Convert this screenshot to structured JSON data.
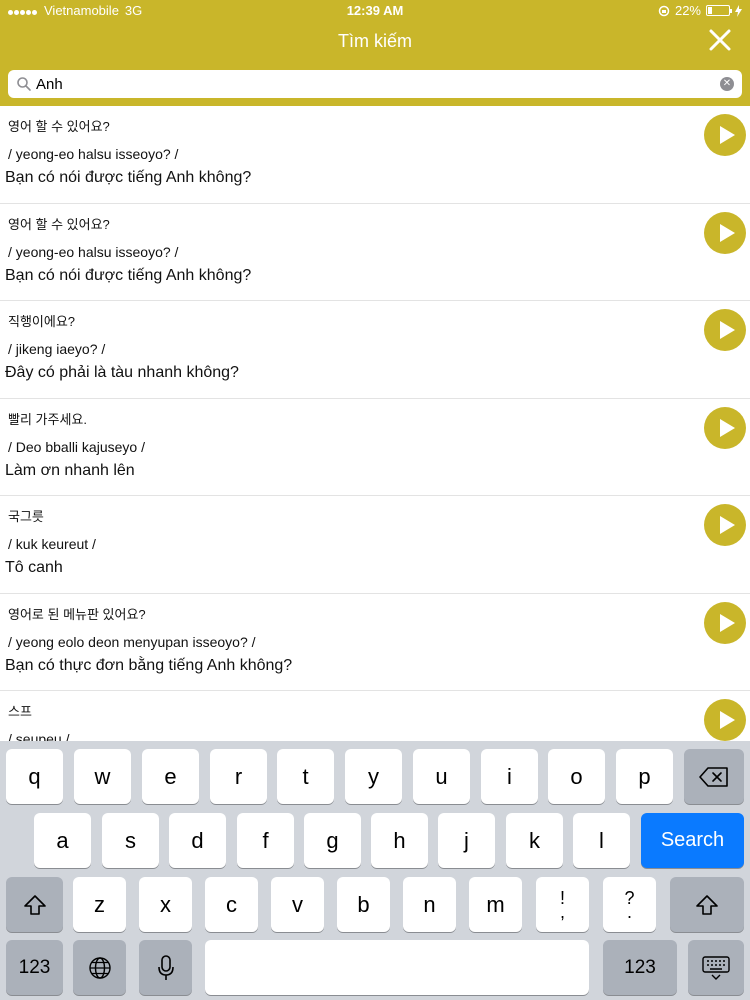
{
  "status_bar": {
    "carrier": "Vietnamobile",
    "network": "3G",
    "time": "12:39 AM",
    "battery": "22%",
    "battery_level": 0.22
  },
  "header": {
    "title": "Tìm kiếm",
    "close_icon": "close-icon"
  },
  "search": {
    "value": "Anh",
    "icon": "search-icon"
  },
  "results": [
    {
      "korean": "영어 할 수 있어요?",
      "romanization": "/ yeong-eo halsu isseoyo? /",
      "vietnamese": "Bạn có nói được tiếng Anh không?"
    },
    {
      "korean": "영어 할 수 있어요?",
      "romanization": "/ yeong-eo halsu isseoyo? /",
      "vietnamese": "Bạn có nói được tiếng Anh không?"
    },
    {
      "korean": "직행이에요?",
      "romanization": "/ jikeng iaeyo? /",
      "vietnamese": "Đây có phải là tàu nhanh không?"
    },
    {
      "korean": "빨리 가주세요.",
      "romanization": "/ Deo bballi kajuseyo /",
      "vietnamese": "Làm ơn nhanh lên"
    },
    {
      "korean": "국그릇",
      "romanization": "/ kuk keureut /",
      "vietnamese": "Tô canh"
    },
    {
      "korean": "영어로 된 메뉴판 있어요?",
      "romanization": "/ yeong eolo deon menyupan isseoyo? /",
      "vietnamese": "Bạn có thực đơn bằng tiếng Anh không?"
    },
    {
      "korean": "스프",
      "romanization": "/ seupeu /",
      "vietnamese": ""
    }
  ],
  "keyboard": {
    "row1": [
      "q",
      "w",
      "e",
      "r",
      "t",
      "y",
      "u",
      "i",
      "o",
      "p"
    ],
    "row2": [
      "a",
      "s",
      "d",
      "f",
      "g",
      "h",
      "j",
      "k",
      "l"
    ],
    "row3": [
      "z",
      "x",
      "c",
      "v",
      "b",
      "n",
      "m"
    ],
    "punct1": [
      "!",
      ","
    ],
    "punct2": [
      "?",
      "."
    ],
    "search_label": "Search",
    "numbers_label": "123",
    "colors": {
      "accent": "#c9b62a",
      "search_key": "#0a7aff",
      "keyboard_bg": "#d1d5db"
    }
  }
}
